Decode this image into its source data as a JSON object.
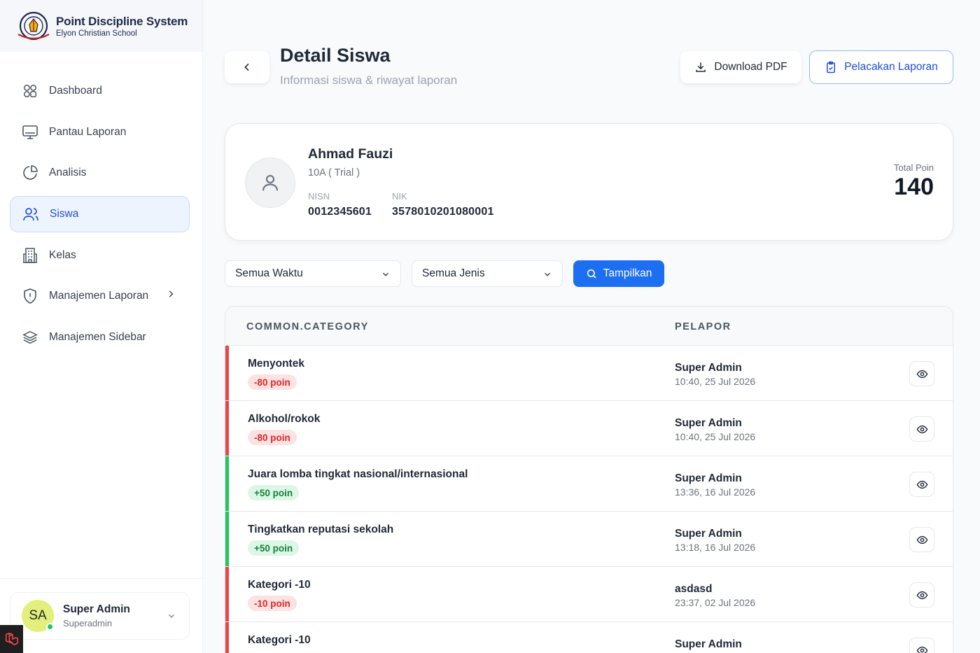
{
  "brand": {
    "title": "Point Discipline System",
    "subtitle": "Elyon Christian School"
  },
  "sidebar": {
    "items": [
      {
        "label": "Dashboard",
        "icon": "dashboard-icon",
        "active": false
      },
      {
        "label": "Pantau Laporan",
        "icon": "monitor-icon",
        "active": false
      },
      {
        "label": "Analisis",
        "icon": "pie-chart-icon",
        "active": false
      },
      {
        "label": "Siswa",
        "icon": "users-icon",
        "active": true
      },
      {
        "label": "Kelas",
        "icon": "building-icon",
        "active": false
      },
      {
        "label": "Manajemen Laporan",
        "icon": "shield-alert-icon",
        "active": false,
        "has_submenu": true
      },
      {
        "label": "Manajemen Sidebar",
        "icon": "layers-icon",
        "active": false
      }
    ]
  },
  "user": {
    "initials": "SA",
    "name": "Super Admin",
    "role": "Superadmin",
    "status_color": "#22c55e"
  },
  "header": {
    "title": "Detail Siswa",
    "subtitle": "Informasi siswa & riwayat laporan",
    "download_label": "Download PDF",
    "track_label": "Pelacakan Laporan"
  },
  "student": {
    "name": "Ahmad Fauzi",
    "class": "10A ( Trial )",
    "nisn_label": "NISN",
    "nisn": "0012345601",
    "nik_label": "NIK",
    "nik": "3578010201080001",
    "total_label": "Total Poin",
    "total": "140"
  },
  "filters": {
    "time": "Semua Waktu",
    "type": "Semua Jenis",
    "show_label": "Tampilkan"
  },
  "table": {
    "headers": [
      "COMMON.CATEGORY",
      "PELAPOR"
    ],
    "rows": [
      {
        "category": "Menyontek",
        "points": "-80 poin",
        "kind": "neg",
        "reporter": "Super Admin",
        "time": "10:40, 25 Jul 2026"
      },
      {
        "category": "Alkohol/rokok",
        "points": "-80 poin",
        "kind": "neg",
        "reporter": "Super Admin",
        "time": "10:40, 25 Jul 2026"
      },
      {
        "category": "Juara lomba tingkat nasional/internasional",
        "points": "+50 poin",
        "kind": "pos",
        "reporter": "Super Admin",
        "time": "13:36, 16 Jul 2026"
      },
      {
        "category": "Tingkatkan reputasi sekolah",
        "points": "+50 poin",
        "kind": "pos",
        "reporter": "Super Admin",
        "time": "13:18, 16 Jul 2026"
      },
      {
        "category": "Kategori -10",
        "points": "-10 poin",
        "kind": "neg",
        "reporter": "asdasd",
        "time": "23:37, 02 Jul 2026"
      },
      {
        "category": "Kategori -10",
        "points": "",
        "kind": "neg",
        "reporter": "Super Admin",
        "time": ""
      }
    ]
  },
  "colors": {
    "accent": "#1d6ff2",
    "negative": "#ef4444",
    "positive": "#22c55e"
  }
}
